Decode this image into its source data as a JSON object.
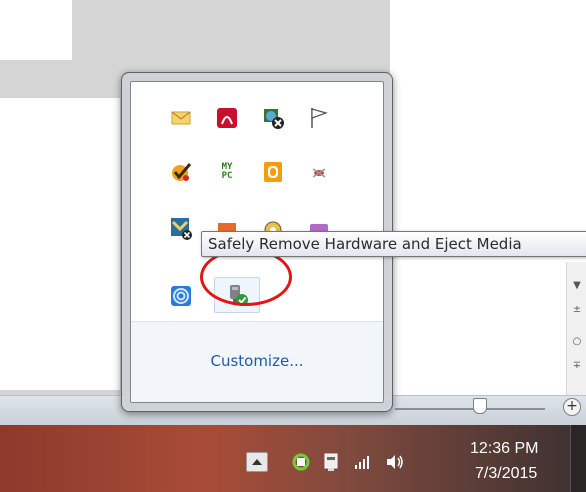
{
  "tooltip": {
    "text": "Safely Remove Hardware and Eject Media"
  },
  "popup": {
    "customize_label": "Customize...",
    "icons": [
      "mail-icon",
      "adobe-icon",
      "network-disconnected-icon",
      "action-center-flag-icon",
      "norton-check-icon",
      "my-pc-icon",
      "office-upload-icon",
      "antimalware-icon",
      "app-update-icon",
      "app-icon-orange",
      "app-icon-gear",
      "app-icon-purple",
      "spiral-icon",
      "safely-remove-hardware-icon"
    ],
    "my_pc_text": "MY\nPC"
  },
  "taskbar": {
    "time": "12:36 PM",
    "date": "7/3/2015",
    "tray_icons": [
      "show-hidden-icons-button",
      "sync-icon",
      "power-icon",
      "network-signal-icon",
      "volume-icon"
    ]
  },
  "background": {
    "status_zoom_plus": "+",
    "scroll_glyphs": [
      "▼",
      "±",
      "○",
      "∓"
    ]
  },
  "colors": {
    "highlight_circle": "#e21414",
    "link": "#1e5aa8",
    "taskbar": "#a94c37"
  }
}
